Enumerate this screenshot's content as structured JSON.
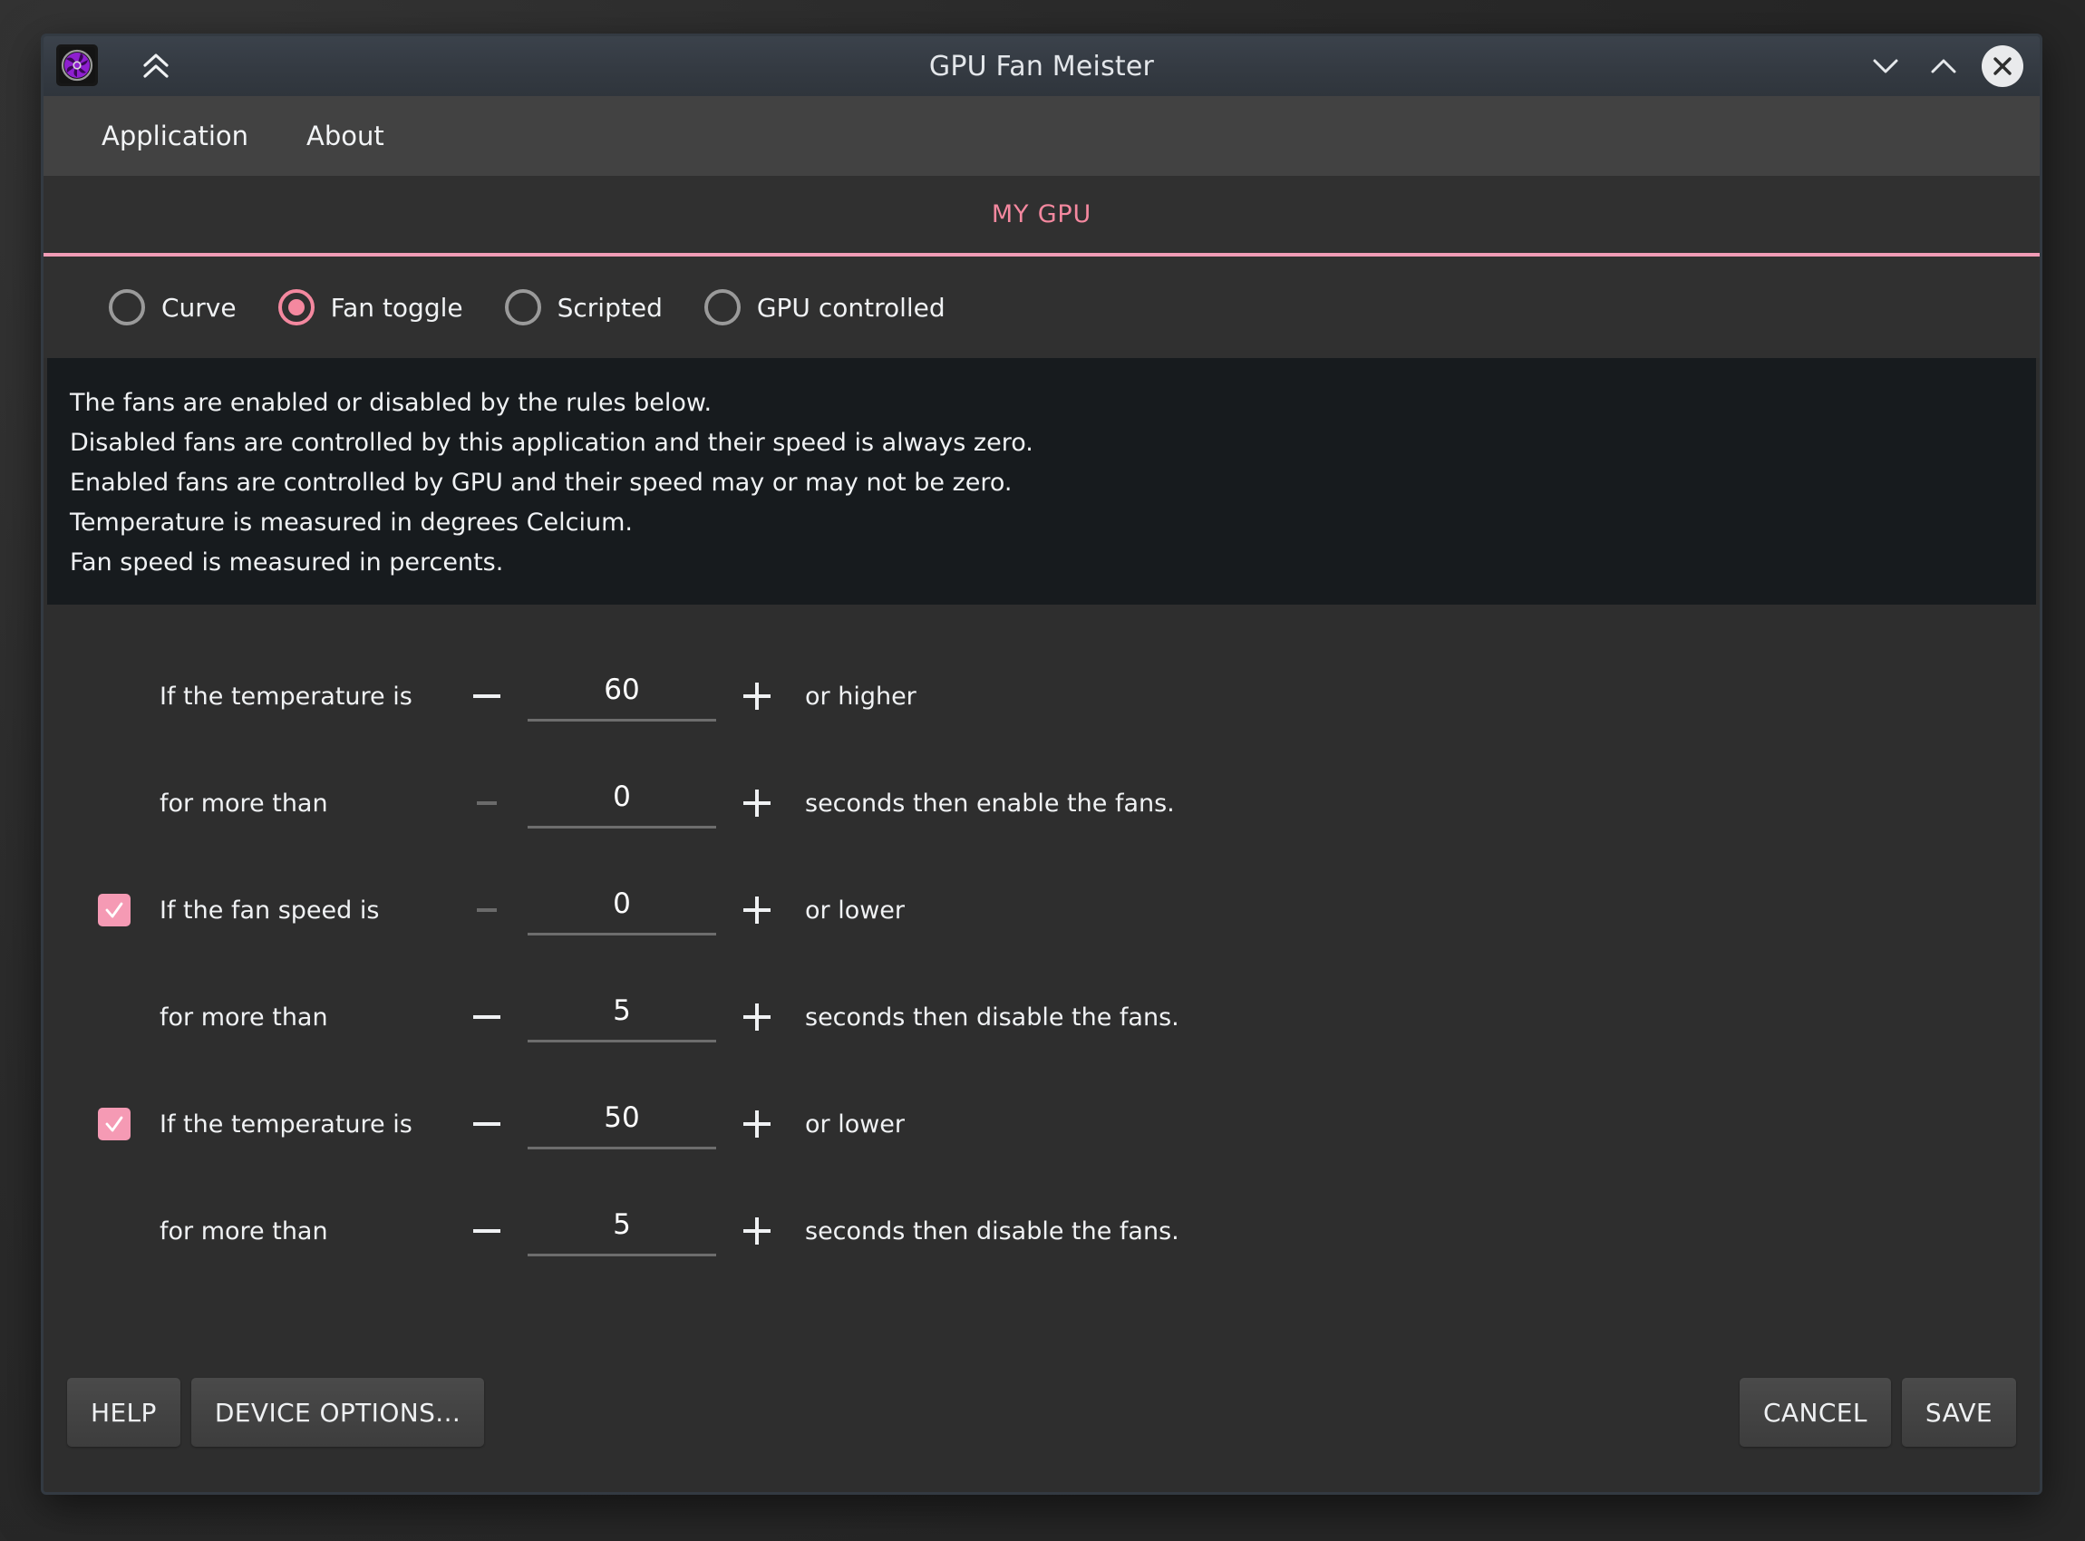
{
  "window": {
    "title": "GPU Fan Meister",
    "app_icon": "fan-icon",
    "collapse_icon": "double-chevron-up-icon",
    "controls": [
      {
        "name": "minimize-button",
        "icon": "chevron-down-icon"
      },
      {
        "name": "maximize-button",
        "icon": "chevron-up-icon"
      },
      {
        "name": "close-button",
        "icon": "close-x-icon"
      }
    ]
  },
  "menubar": {
    "items": [
      {
        "label": "Application"
      },
      {
        "label": "About"
      }
    ]
  },
  "tabs": [
    {
      "label": "MY GPU",
      "active": true
    }
  ],
  "modes": [
    {
      "label": "Curve",
      "selected": false
    },
    {
      "label": "Fan toggle",
      "selected": true
    },
    {
      "label": "Scripted",
      "selected": false
    },
    {
      "label": "GPU controlled",
      "selected": false
    }
  ],
  "description": [
    "The fans are enabled or disabled by the rules below.",
    "Disabled fans are controlled by this application and their speed is always zero.",
    "Enabled fans are controlled by GPU and their speed may or may not be zero.",
    "Temperature is measured in degrees Celcium.",
    "Fan speed is measured in percents."
  ],
  "rules": [
    {
      "has_checkbox": false,
      "checked": false,
      "label": "If the temperature is",
      "minus_enabled": true,
      "value": "60",
      "plus_enabled": true,
      "suffix": "or higher"
    },
    {
      "has_checkbox": false,
      "checked": false,
      "label": "for more than",
      "minus_enabled": false,
      "value": "0",
      "plus_enabled": true,
      "suffix": "seconds then enable the fans."
    },
    {
      "has_checkbox": true,
      "checked": true,
      "label": "If the fan speed is",
      "minus_enabled": false,
      "value": "0",
      "plus_enabled": true,
      "suffix": "or lower"
    },
    {
      "has_checkbox": false,
      "checked": false,
      "label": "for more than",
      "minus_enabled": true,
      "value": "5",
      "plus_enabled": true,
      "suffix": "seconds then disable the fans."
    },
    {
      "has_checkbox": true,
      "checked": true,
      "label": "If the temperature is",
      "minus_enabled": true,
      "value": "50",
      "plus_enabled": true,
      "suffix": "or lower"
    },
    {
      "has_checkbox": false,
      "checked": false,
      "label": "for more than",
      "minus_enabled": true,
      "value": "5",
      "plus_enabled": true,
      "suffix": "seconds then disable the fans."
    }
  ],
  "footer": {
    "help_label": "HELP",
    "device_options_label": "DEVICE OPTIONS...",
    "cancel_label": "CANCEL",
    "save_label": "SAVE"
  },
  "colors": {
    "accent_pink": "#f4889f",
    "checkbox_pink": "#f59ab4",
    "window_bg": "#2e2e2e",
    "menubar_bg": "#424242",
    "description_bg": "#171b1e",
    "titlebar_bg": "#343a42"
  }
}
